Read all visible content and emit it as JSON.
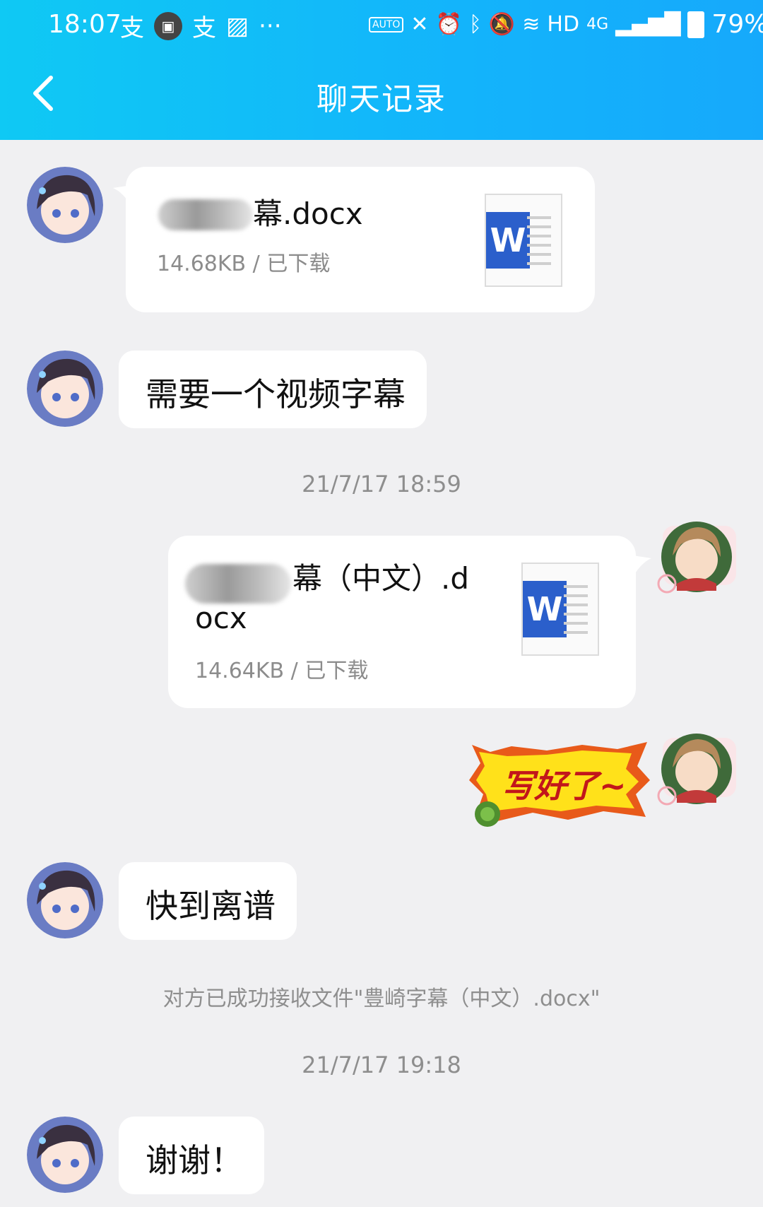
{
  "status_bar": {
    "time": "18:07",
    "battery": "79%",
    "network_hd": "HD",
    "network_4g": "4G",
    "auto_label": "AUTO",
    "icons": [
      "alipay-icon",
      "app-icon",
      "alipay-icon",
      "image-icon",
      "more-dots-icon",
      "auto-icon",
      "x-icon",
      "alarm-icon",
      "bluetooth-icon",
      "mute-icon",
      "wifi-icon",
      "signal-icon",
      "battery-icon"
    ]
  },
  "header": {
    "title": "聊天记录",
    "back_icon": "back-arrow-icon"
  },
  "messages": [
    {
      "side": "left",
      "type": "file",
      "name_visible": "幕.docx",
      "meta": "14.68KB / 已下载"
    },
    {
      "side": "left",
      "type": "text",
      "text": "需要一个视频字幕"
    },
    {
      "type": "timestamp",
      "text": "21/7/17 18:59"
    },
    {
      "side": "right",
      "type": "file",
      "name_line1_visible": "幕（中文）.d",
      "name_line2": "ocx",
      "meta": "14.64KB / 已下载"
    },
    {
      "side": "right",
      "type": "sticker",
      "text": "写好了~"
    },
    {
      "side": "left",
      "type": "text",
      "text": "快到离谱"
    },
    {
      "type": "system",
      "text": "对方已成功接收文件\"豊崎字幕（中文）.docx\""
    },
    {
      "type": "timestamp",
      "text": "21/7/17 19:18"
    },
    {
      "side": "left",
      "type": "text",
      "text": "谢谢！"
    }
  ],
  "colors": {
    "header_gradient_start": "#0fc9f4",
    "header_gradient_end": "#16a9fb",
    "background": "#f0f0f2",
    "bubble": "#ffffff",
    "word_blue": "#2b5fcb",
    "sticker_yellow": "#ffe11a"
  }
}
